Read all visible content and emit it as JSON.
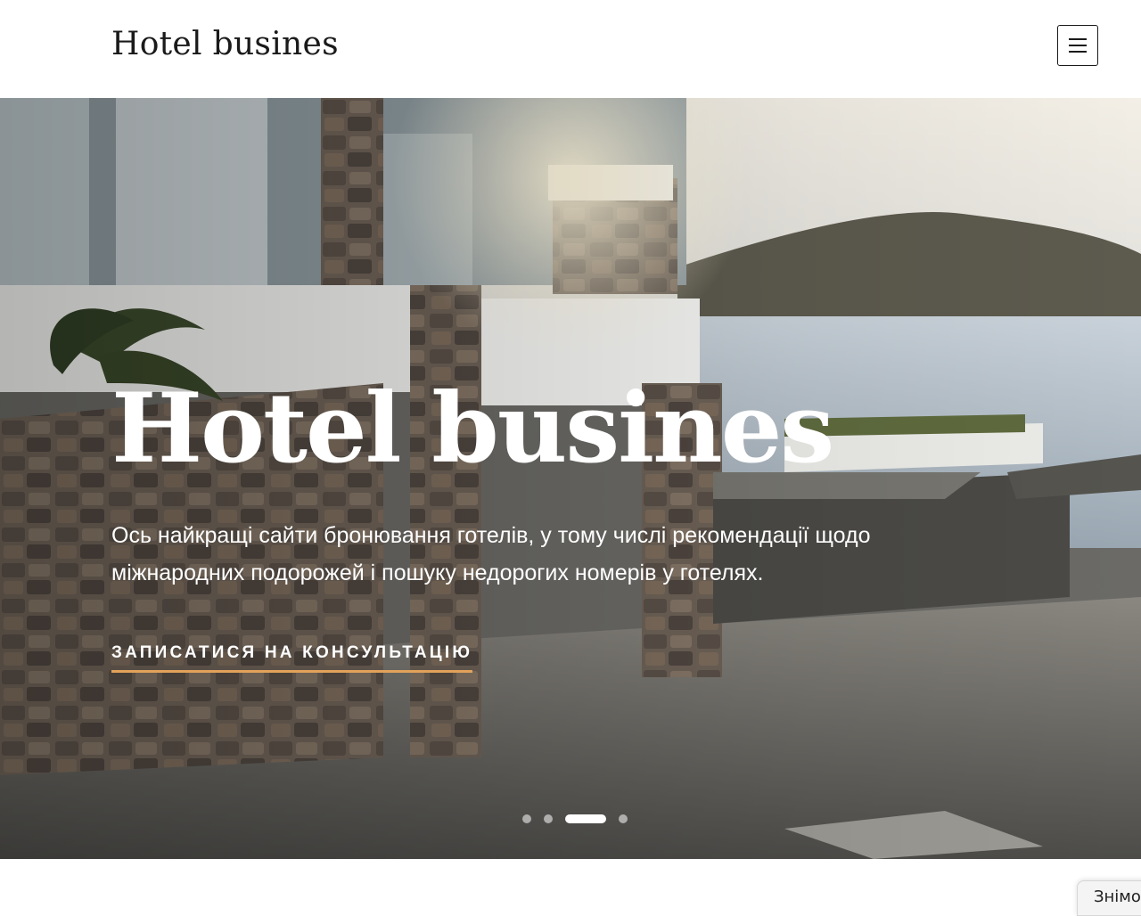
{
  "header": {
    "site_title": "Hotel busines",
    "menu_icon": "hamburger-menu-icon"
  },
  "hero": {
    "title": "Hotel busines",
    "description": "Ось найкращі сайти бронювання готелів, у тому числі рекомендації щодо міжнародних подорожей і пошуку недорогих номерів у готелях.",
    "cta_label": "ЗАПИСАТИСЯ НА КОНСУЛЬТАЦІЮ",
    "slides_total": 4,
    "active_slide": 3
  },
  "floating_tab": {
    "label": "Знімо"
  },
  "colors": {
    "cta_underline": "#e2a25a",
    "text_dark": "#1a1a1a",
    "hero_text": "#ffffff"
  }
}
